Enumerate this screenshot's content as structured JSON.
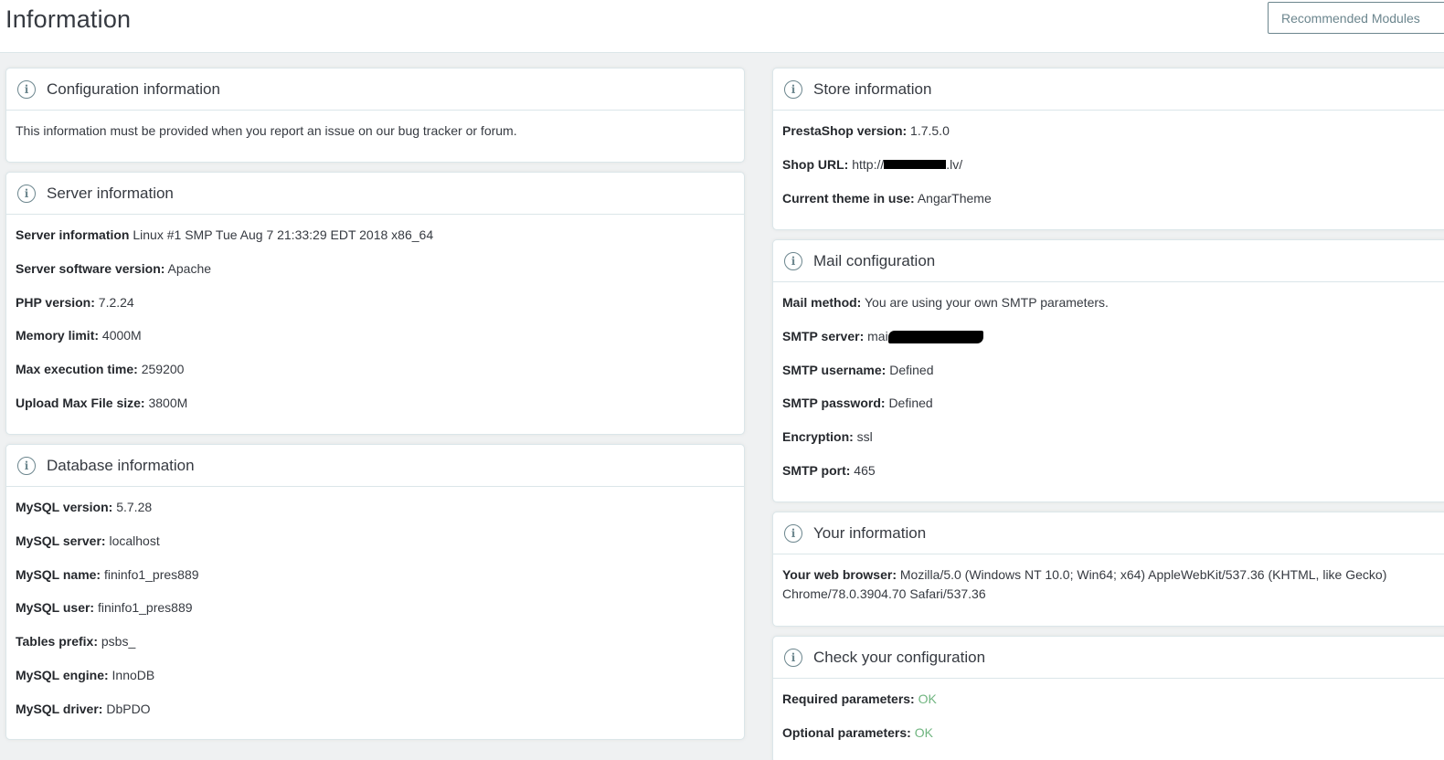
{
  "header": {
    "title": "Information",
    "recommended_label": "Recommended Modules"
  },
  "config": {
    "title": "Configuration information",
    "text": "This information must be provided when you report an issue on our bug tracker or forum."
  },
  "server": {
    "title": "Server information",
    "rows": [
      {
        "label": "Server information",
        "value": "Linux #1 SMP Tue Aug 7 21:33:29 EDT 2018 x86_64"
      },
      {
        "label": "Server software version:",
        "value": "Apache"
      },
      {
        "label": "PHP version:",
        "value": "7.2.24"
      },
      {
        "label": "Memory limit:",
        "value": "4000M"
      },
      {
        "label": "Max execution time:",
        "value": "259200"
      },
      {
        "label": "Upload Max File size:",
        "value": "3800M"
      }
    ]
  },
  "database": {
    "title": "Database information",
    "rows": [
      {
        "label": "MySQL version:",
        "value": "5.7.28"
      },
      {
        "label": "MySQL server:",
        "value": "localhost"
      },
      {
        "label": "MySQL name:",
        "value": "fininfo1_pres889"
      },
      {
        "label": "MySQL user:",
        "value": "fininfo1_pres889"
      },
      {
        "label": "Tables prefix:",
        "value": "psbs_"
      },
      {
        "label": "MySQL engine:",
        "value": "InnoDB"
      },
      {
        "label": "MySQL driver:",
        "value": "DbPDO"
      }
    ]
  },
  "store": {
    "title": "Store information",
    "version_label": "PrestaShop version:",
    "version_value": "1.7.5.0",
    "url_label": "Shop URL:",
    "url_prefix": "http://",
    "url_suffix": ".lv/",
    "theme_label": "Current theme in use:",
    "theme_value": "AngarTheme"
  },
  "mail": {
    "title": "Mail configuration",
    "method_label": "Mail method:",
    "method_value": "You are using your own SMTP parameters.",
    "server_label": "SMTP server:",
    "server_prefix": "mai",
    "rows": [
      {
        "label": "SMTP username:",
        "value": "Defined"
      },
      {
        "label": "SMTP password:",
        "value": "Defined"
      },
      {
        "label": "Encryption:",
        "value": "ssl"
      },
      {
        "label": "SMTP port:",
        "value": "465"
      }
    ]
  },
  "you": {
    "title": "Your information",
    "browser_label": "Your web browser:",
    "browser_value": "Mozilla/5.0 (Windows NT 10.0; Win64; x64) AppleWebKit/537.36 (KHTML, like Gecko) Chrome/78.0.3904.70 Safari/537.36"
  },
  "check": {
    "title": "Check your configuration",
    "rows": [
      {
        "label": "Required parameters:",
        "value": "OK"
      },
      {
        "label": "Optional parameters:",
        "value": "OK"
      }
    ]
  },
  "colors": {
    "ok": "#70b580",
    "accent": "#6c868e"
  }
}
